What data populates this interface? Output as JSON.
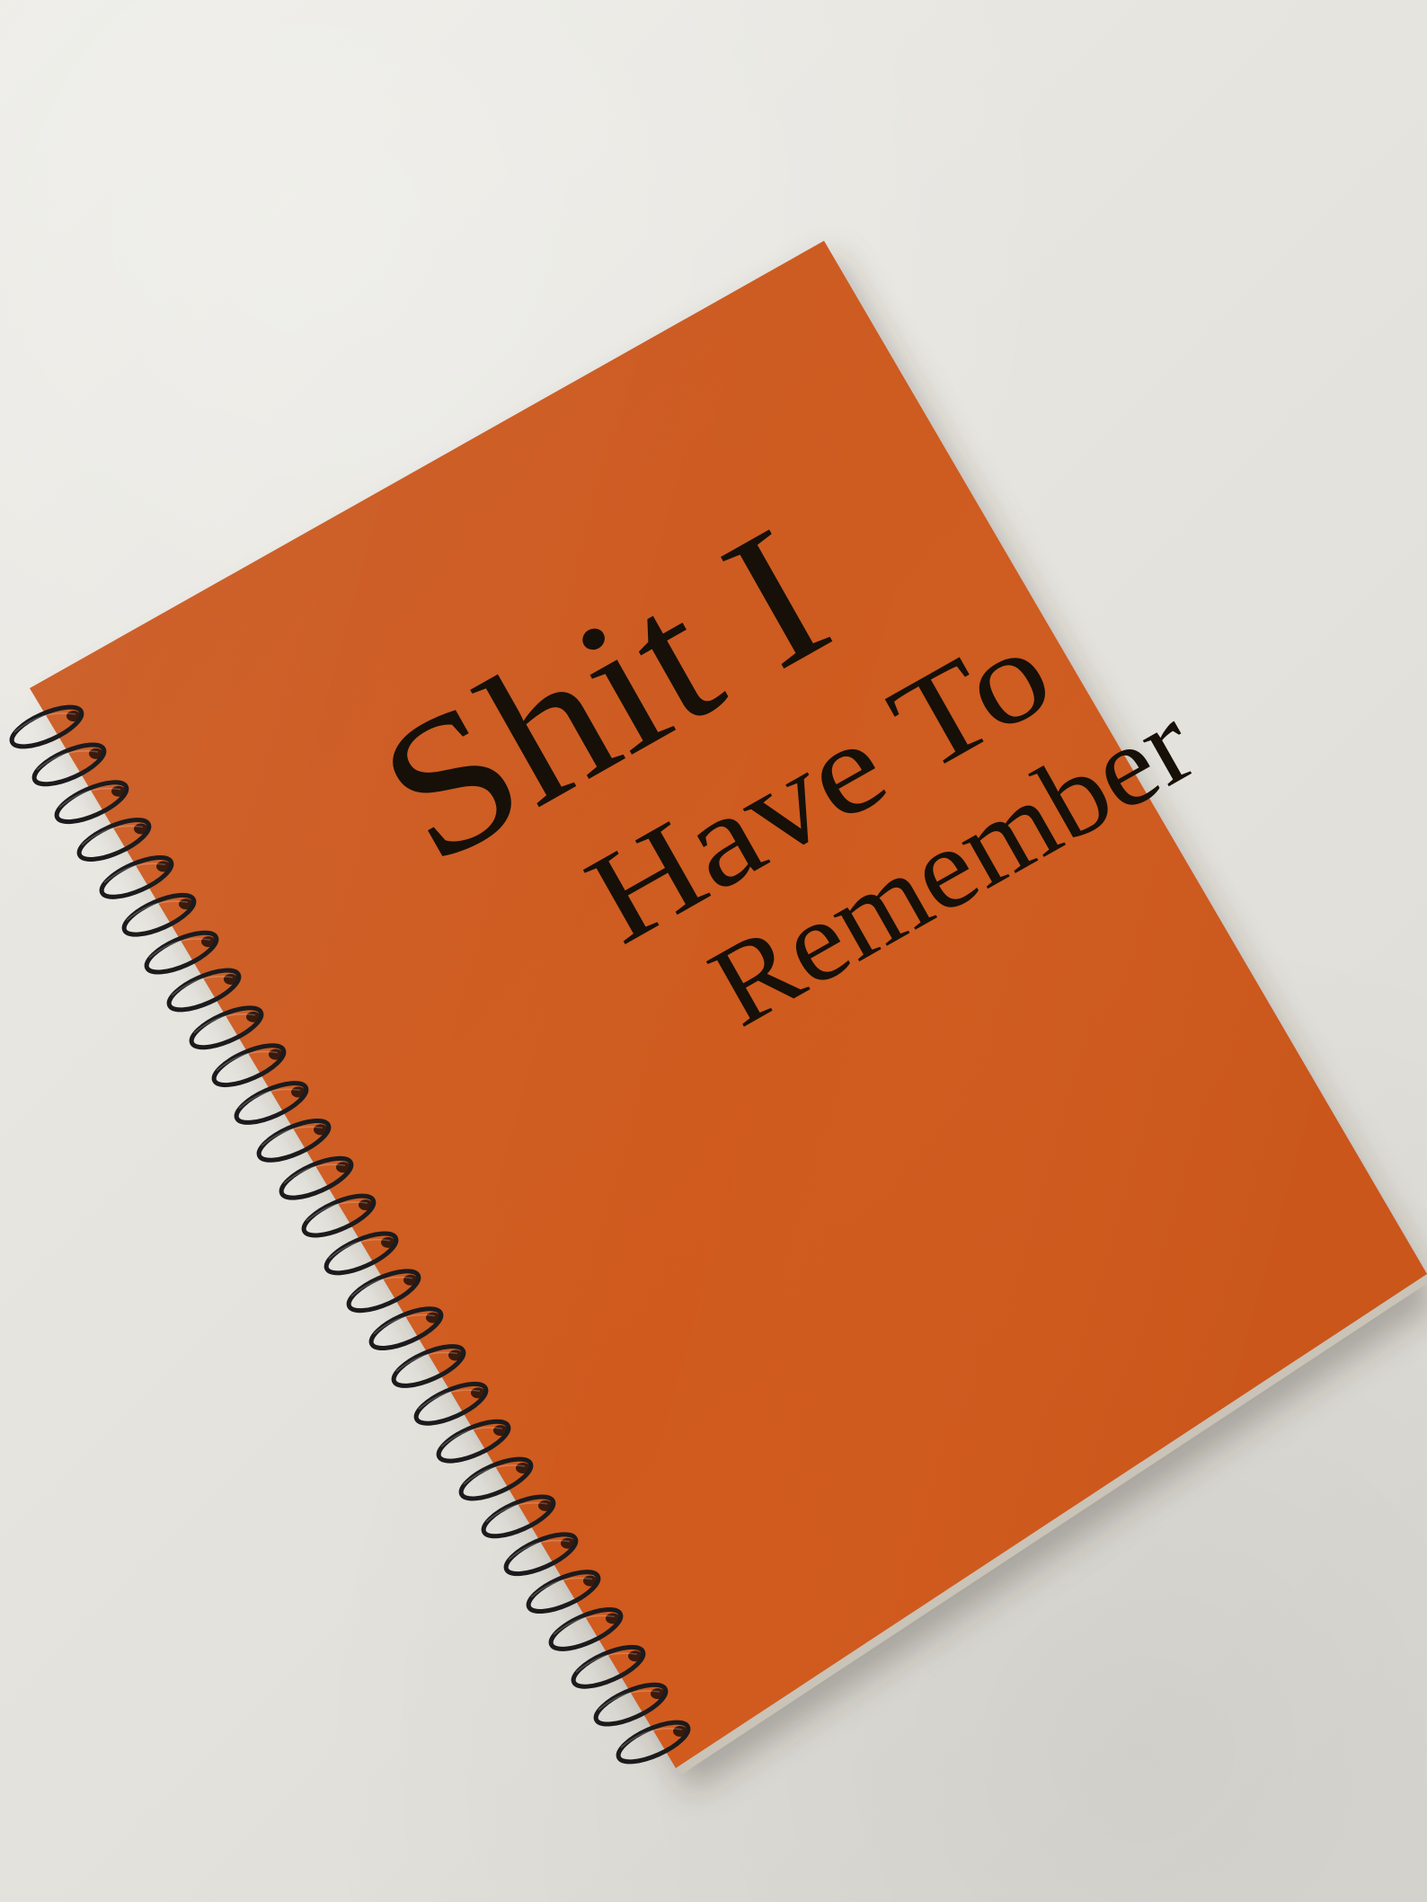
{
  "cover": {
    "title_lines": [
      "Shit I",
      "Have To",
      "Remember"
    ]
  },
  "colors": {
    "background": "#e7e5e0",
    "cover": "#cc5a1f",
    "cover_edge": "#b84d18",
    "text": "#161009",
    "spiral": "#1b1b1d"
  },
  "spiral": {
    "ring_count": 28
  }
}
